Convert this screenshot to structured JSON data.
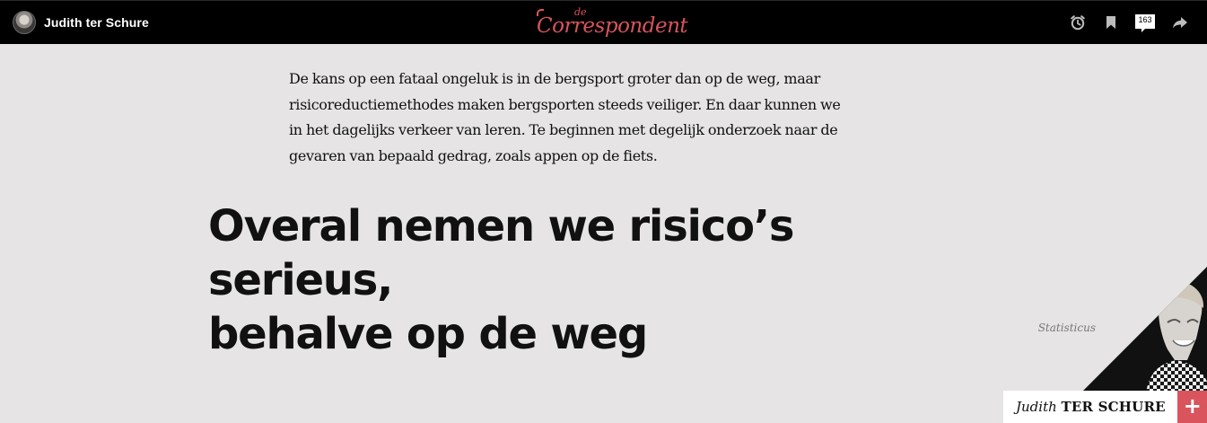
{
  "header": {
    "author_name": "Judith ter Schure",
    "logo_small": "de",
    "logo_main": "Correspondent",
    "comment_count": "163",
    "icons": [
      "clock-icon",
      "bookmark-icon",
      "comments-icon",
      "share-icon"
    ],
    "brand_color": "#d9545c"
  },
  "article": {
    "intro": "De kans op een fataal ongeluk is in de bergsport groter dan op de weg, maar risicoreductiemethodes maken bergsporten steeds veiliger. En daar kunnen we in het dagelijks verkeer van leren. Te beginnen met degelijk onderzoek naar de gevaren van bepaald gedrag, zoals appen op de fiets.",
    "headline_line1": "Overal nemen we risico’s serieus,",
    "headline_line2": "behalve op de weg"
  },
  "author_card": {
    "role": "Statisticus",
    "first_name": "Judith",
    "last_name": "TER SCHURE",
    "plus_label": "+"
  },
  "colors": {
    "background": "#e6e4e4",
    "topbar": "#000000",
    "accent": "#d9545c"
  }
}
